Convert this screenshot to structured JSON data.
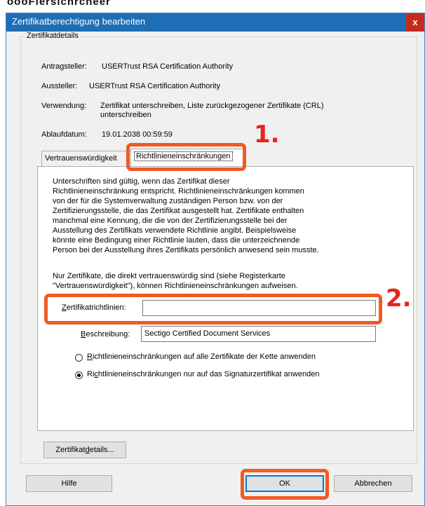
{
  "top_strip_text": "oooFiersichrcheer",
  "dialog": {
    "title": "Zertifikatberechtigung bearbeiten",
    "close_glyph": "x"
  },
  "details": {
    "legend": "Zertifikatdetails",
    "antragsteller_label": "Antragsteller:",
    "antragsteller_value": "USERTrust RSA Certification Authority",
    "aussteller_label": "Aussteller:",
    "aussteller_value": "USERTrust RSA Certification Authority",
    "verwendung_label": "Verwendung:",
    "verwendung_value_line1": "Zertifikat unterschreiben, Liste zurückgezogener Zertifikate (CRL)",
    "verwendung_value_line2": "unterschreiben",
    "ablaufdatum_label": "Ablaufdatum:",
    "ablaufdatum_value": "19.01.2038 00:59:59"
  },
  "tabs": {
    "trust": "Vertrauenswürdigkeit",
    "policy": "Richtlinieneinschränkungen"
  },
  "policy_panel": {
    "description_lines": [
      "Unterschriften sind gültig, wenn das Zertifikat dieser",
      "Richtlinieneinschränkung entspricht. Richtlinieneinschränkungen kommen",
      "von der für die Systemverwaltung zuständigen Person bzw. von der",
      "Zertifizierungsstelle, die das Zertifikat ausgestellt hat. Zertifikate enthalten",
      "manchmal eine Kennung, die die von der Zertifizierungsstelle bei der",
      "Ausstellung des Zertifikats verwendete Richtlinie angibt. Beispielsweise",
      "könnte eine Bedingung einer Richtlinie lauten, dass die unterzeichnende",
      "Person bei der Ausstellung ihres Zertifikats persönlich anwesend sein musste."
    ],
    "note_lines": [
      "Nur Zertifikate, die direkt vertrauenswürdig sind (siehe Registerkarte",
      "\"Vertrauenswürdigkeit\"), können Richtlinieneinschränkungen aufweisen."
    ],
    "policies_label_first": "Z",
    "policies_label_rest": "ertifikatrichtlinien:",
    "policies_value": "",
    "beschreibung_label_first": "B",
    "beschreibung_label_rest": "eschreibung:",
    "beschreibung_value": "Sectigo Certified Document Services",
    "radio_all_first": "R",
    "radio_all_rest": "ichtlinieneinschränkungen auf alle Zertifikate der Kette anwenden",
    "radio_all_selected": false,
    "radio_sig_pre": "Ri",
    "radio_sig_under": "c",
    "radio_sig_rest": "htlinieneinschränkungen nur auf das Signaturzertifikat anwenden",
    "radio_sig_selected": true
  },
  "buttons": {
    "details_pre": "Zertifikat",
    "details_under": "d",
    "details_rest": "etails...",
    "help": "Hilfe",
    "ok": "OK",
    "cancel": "Abbrechen"
  },
  "annotations": {
    "step1": "1.",
    "step2": "2.",
    "color": "#f15a22"
  }
}
